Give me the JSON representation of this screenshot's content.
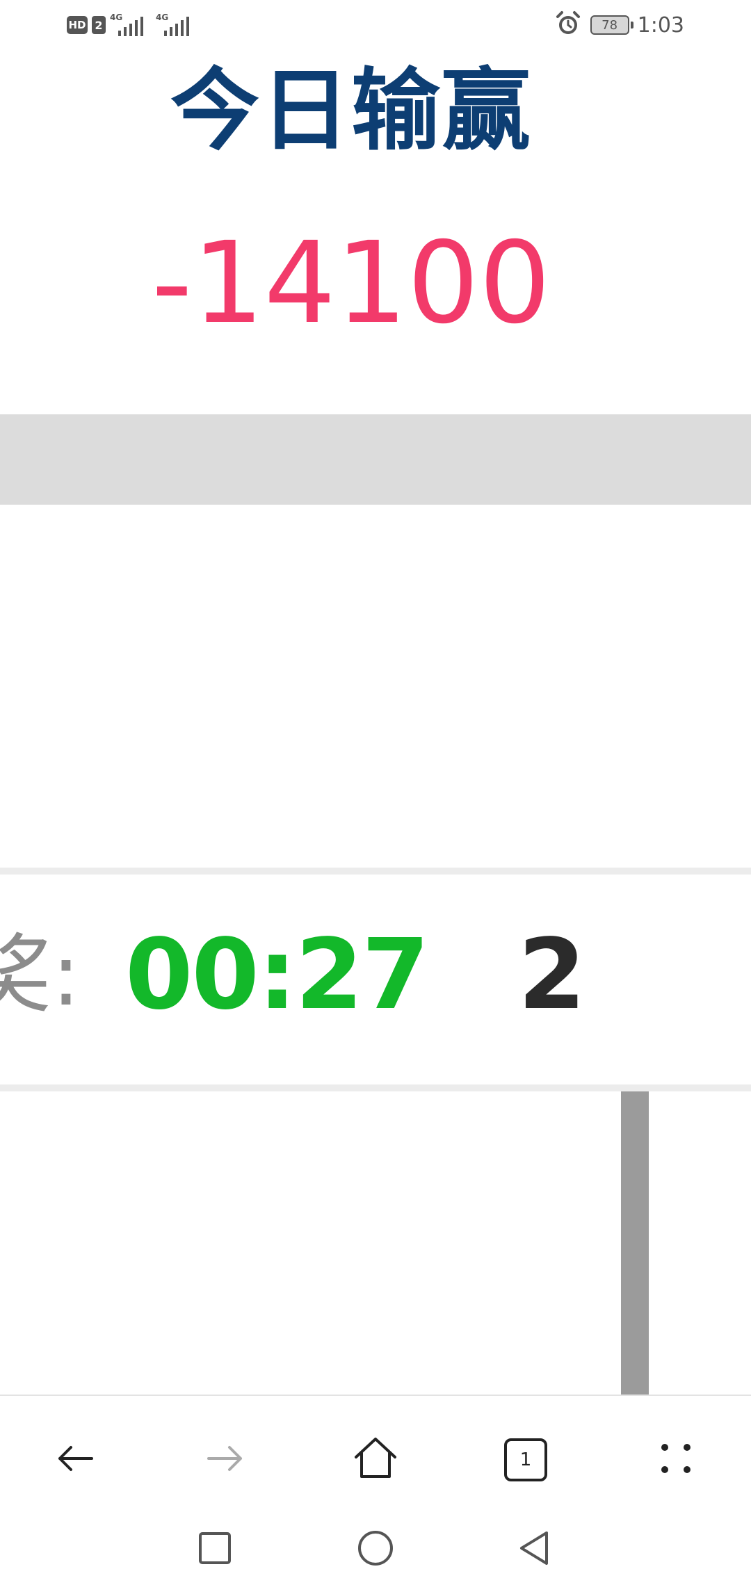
{
  "status_bar": {
    "hd_label": "HD",
    "sim_label": "2",
    "network_1": "4G",
    "network_2": "4G",
    "battery_level": "78",
    "time": "1:03",
    "icons": [
      "alarm-icon",
      "battery-icon",
      "signal-icon"
    ]
  },
  "header": {
    "title": "今日输赢",
    "amount": "-14100"
  },
  "countdown": {
    "label": "奖:",
    "time": "00:27",
    "number": "2"
  },
  "toolbar": {
    "tab_count": "1",
    "icons": [
      "back-arrow-icon",
      "forward-arrow-icon",
      "home-icon",
      "tabs-icon",
      "menu-dots-icon"
    ]
  },
  "system_nav": {
    "icons": [
      "recents-square-icon",
      "home-circle-icon",
      "back-triangle-icon"
    ]
  },
  "colors": {
    "title": "#0d3e73",
    "amount": "#f23a6a",
    "countdown_time": "#13b82a",
    "label": "#8c8c8c",
    "band": "#dcdcdc"
  }
}
